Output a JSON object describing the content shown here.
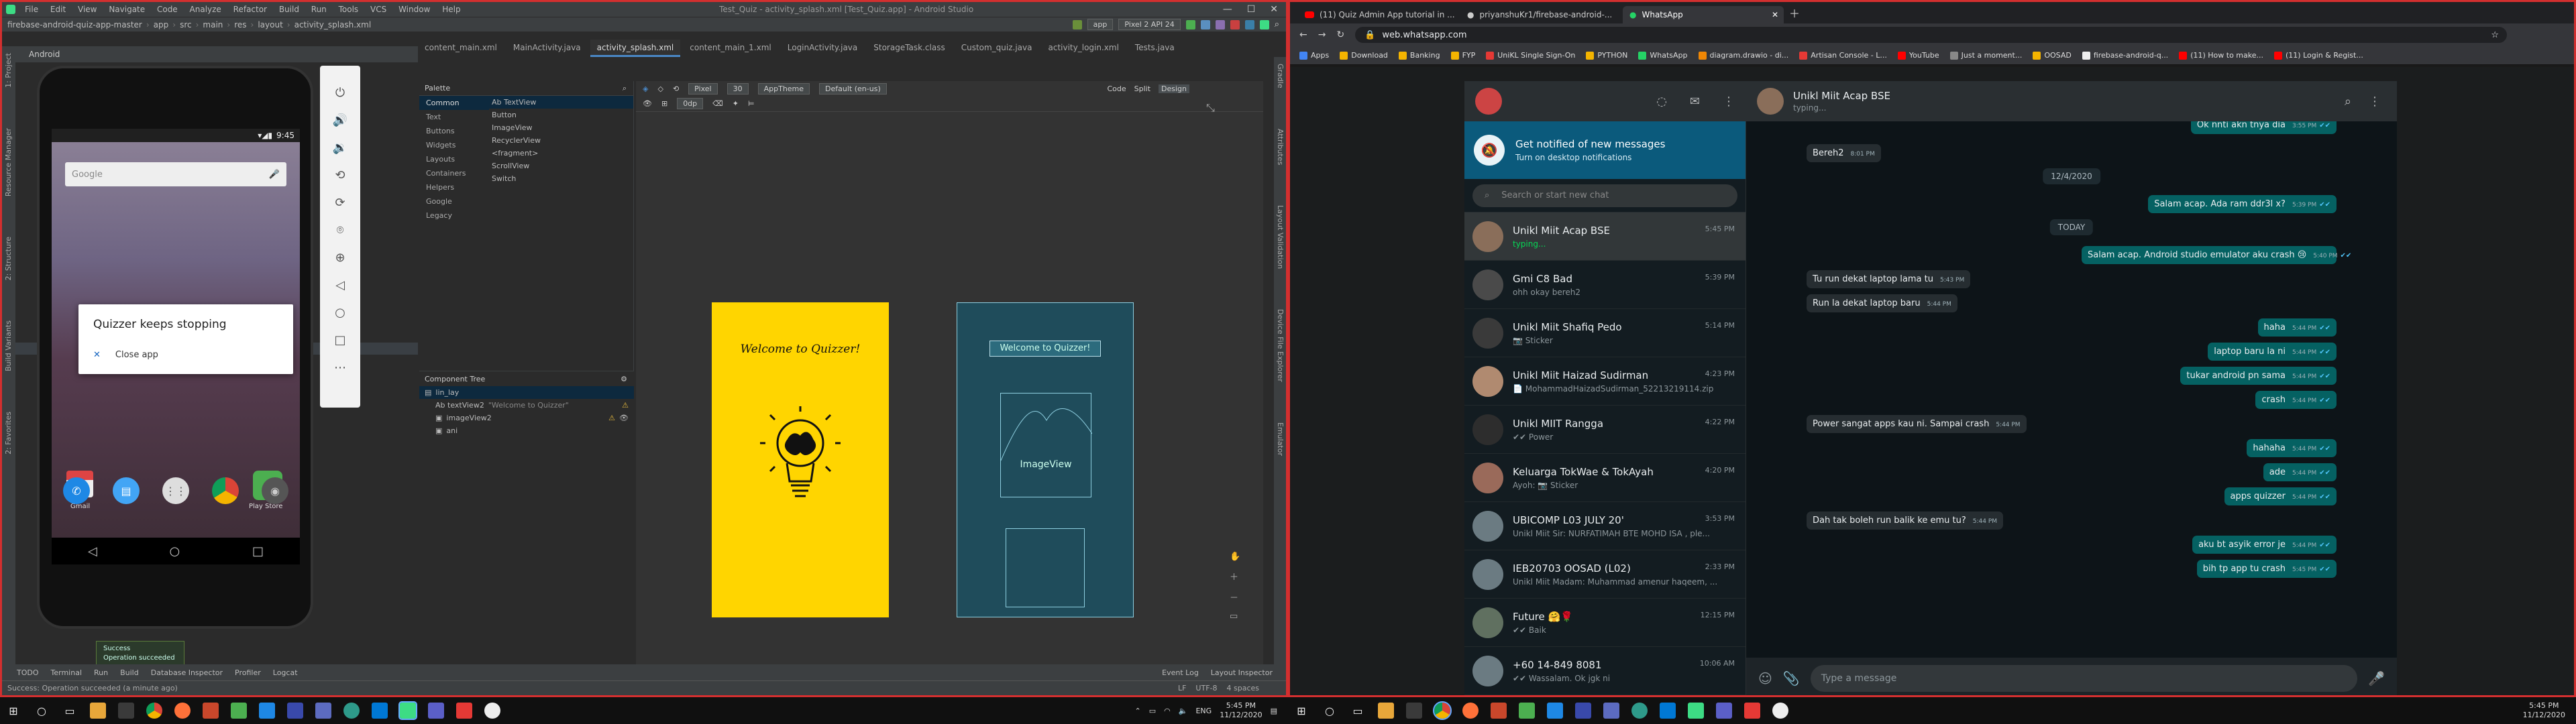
{
  "android_studio": {
    "window_title": "Test_Quiz - activity_splash.xml [Test_Quiz.app] - Android Studio",
    "project_name": "firebase-android-quiz-app-master",
    "menu": [
      "File",
      "Edit",
      "View",
      "Navigate",
      "Code",
      "Analyze",
      "Refactor",
      "Build",
      "Run",
      "Tools",
      "VCS",
      "Window",
      "Help"
    ],
    "breadcrumb": [
      "app",
      "src",
      "main",
      "res",
      "layout",
      "activity_splash.xml"
    ],
    "run_config": "app",
    "device": "Pixel 2 API 24",
    "file_tabs": [
      "content_main.xml",
      "MainActivity.java",
      "activity_splash.xml",
      "content_main_1.xml",
      "LoginActivity.java",
      "StorageTask.class",
      "Custom_quiz.java",
      "activity_login.xml",
      "Tests.java"
    ],
    "active_tab_index": 2,
    "project_view": "Android",
    "view_modes": [
      "Code",
      "Split",
      "Design"
    ],
    "palette": {
      "title": "Palette",
      "categories": [
        "Common",
        "Text",
        "Buttons",
        "Widgets",
        "Layouts",
        "Containers",
        "Helpers",
        "Google",
        "Legacy"
      ],
      "items": [
        "Ab TextView",
        "Button",
        "ImageView",
        "RecyclerView",
        "<fragment>",
        "ScrollView",
        "Switch"
      ]
    },
    "design_toolbar": {
      "device": "Pixel",
      "api": "30",
      "theme": "AppTheme",
      "locale": "Default (en-us)",
      "margin": "0dp"
    },
    "component_tree": {
      "title": "Component Tree",
      "root": "lin_lay",
      "children": [
        {
          "label": "Ab textView2",
          "extra": "\"Welcome to Quizzer\"",
          "warning": true
        },
        {
          "label": "imageView2",
          "extra": "",
          "warning": true
        },
        {
          "label": "ani",
          "extra": "",
          "warning": false
        }
      ]
    },
    "design_preview": {
      "welcome_text": "Welcome to Quizzer!",
      "blueprint_text": "Welcome to Quizzer!",
      "imageview_label": "ImageView"
    },
    "emulator": {
      "time": "9:45",
      "search_placeholder": "Google",
      "dialog_title": "Quizzer keeps stopping",
      "dialog_action": "Close app",
      "apps": [
        "Gmail",
        "Play Store"
      ]
    },
    "toast": {
      "line1": "Success",
      "line2": "Operation succeeded"
    },
    "bottom_tools": [
      "TODO",
      "Terminal",
      "Run",
      "Build",
      "Database Inspector",
      "Profiler",
      "Logcat",
      "Event Log",
      "Layout Inspector"
    ],
    "status_text": "Success: Operation succeeded (a minute ago)",
    "status_right": [
      "LF",
      "UTF-8",
      "4 spaces"
    ],
    "left_strip": [
      "1: Project",
      "Resource Manager",
      "2: Structure",
      "Build Variants",
      "2: Favorites"
    ],
    "right_strip": [
      "Gradle",
      "Attributes",
      "Layout Validation",
      "Device File Explorer",
      "Emulator"
    ]
  },
  "chrome": {
    "tabs": [
      {
        "title": "(11) Quiz Admin App tutorial in ..."
      },
      {
        "title": "priyanshuKr1/firebase-android-..."
      },
      {
        "title": "WhatsApp"
      }
    ],
    "active_tab": 2,
    "url": "web.whatsapp.com",
    "bookmarks": [
      "Apps",
      "Download",
      "Banking",
      "FYP",
      "UniKL Single Sign-On",
      "PYTHON",
      "WhatsApp",
      "diagram.drawio - di...",
      "Artisan Console - L...",
      "YouTube",
      "Just a moment...",
      "OOSAD",
      "firebase-android-q...",
      "(11) How to make...",
      "(11) Login & Regist..."
    ]
  },
  "whatsapp": {
    "notification_title": "Get notified of new messages",
    "notification_sub": "Turn on desktop notifications",
    "search_placeholder": "Search or start new chat",
    "active_chat": {
      "name": "Unikl Miit Acap BSE",
      "status": "typing..."
    },
    "chats": [
      {
        "name": "Unikl Miit Acap BSE",
        "time": "5:45 PM",
        "preview": "typing...",
        "typing": true,
        "color": "#8a6e5a"
      },
      {
        "name": "Gmi C8 Bad",
        "time": "5:39 PM",
        "preview": "ohh okay bereh2",
        "typing": false,
        "color": "#4a4a4a"
      },
      {
        "name": "Unikl Miit Shafiq Pedo",
        "time": "5:14 PM",
        "preview": "📷 Sticker",
        "typing": false,
        "color": "#3a3a3a"
      },
      {
        "name": "Unikl Miit Haizad Sudirman",
        "time": "4:23 PM",
        "preview": "📄 MohammadHaizadSudirman_52213219114.zip",
        "typing": false,
        "color": "#b08a70"
      },
      {
        "name": "Unikl MIIT Rangga",
        "time": "4:22 PM",
        "preview": "✔✔ Power",
        "typing": false,
        "color": "#2d2d2d"
      },
      {
        "name": "Keluarga TokWae & TokAyah",
        "time": "4:20 PM",
        "preview": "Ayoh: 📷 Sticker",
        "typing": false,
        "color": "#9a6a5a"
      },
      {
        "name": "UBICOMP L03 JULY 20'",
        "time": "3:53 PM",
        "preview": "Unikl Miit Sir: NURFATIMAH BTE MOHD ISA , ple...",
        "typing": false,
        "color": "#6b7b82"
      },
      {
        "name": "IEB20703 OOSAD (L02)",
        "time": "2:33 PM",
        "preview": "Unikl Miit Madam: Muhammad amenur haqeem, ...",
        "typing": false,
        "color": "#6b7b82"
      },
      {
        "name": "Future 🤗🌹",
        "time": "12:15 PM",
        "preview": "✔✔ Baik",
        "typing": false,
        "color": "#607060"
      },
      {
        "name": "+60 14-849 8081",
        "time": "10:06 AM",
        "preview": "✔✔ Wassalam. Ok jgk ni",
        "typing": false,
        "color": "#6b7b82"
      }
    ],
    "messages": [
      {
        "dir": "out",
        "text": "Ok nnti akn tnya dia",
        "time": "3:55 PM"
      },
      {
        "dir": "in",
        "text": "Bereh2",
        "time": "8:01 PM"
      },
      {
        "dir": "day",
        "text": "12/4/2020"
      },
      {
        "dir": "out",
        "text": "Salam acap. Ada ram ddr3l x?",
        "time": "5:39 PM"
      },
      {
        "dir": "day",
        "text": "TODAY"
      },
      {
        "dir": "out",
        "text": "Salam acap. Android studio emulator aku crash 😢",
        "time": "5:40 PM"
      },
      {
        "dir": "in",
        "text": "Tu run dekat laptop lama tu",
        "time": "5:43 PM"
      },
      {
        "dir": "in",
        "text": "Run la dekat laptop baru",
        "time": "5:44 PM"
      },
      {
        "dir": "out",
        "text": "haha",
        "time": "5:44 PM"
      },
      {
        "dir": "out",
        "text": "laptop baru la ni",
        "time": "5:44 PM"
      },
      {
        "dir": "out",
        "text": "tukar android pn sama",
        "time": "5:44 PM"
      },
      {
        "dir": "out",
        "text": "crash",
        "time": "5:44 PM"
      },
      {
        "dir": "in",
        "text": "Power sangat apps kau ni. Sampai crash",
        "time": "5:44 PM"
      },
      {
        "dir": "out",
        "text": "hahaha",
        "time": "5:44 PM"
      },
      {
        "dir": "out",
        "text": "ade",
        "time": "5:44 PM"
      },
      {
        "dir": "out",
        "text": "apps quizzer",
        "time": "5:44 PM"
      },
      {
        "dir": "in",
        "text": "Dah tak boleh run balik ke emu tu?",
        "time": "5:44 PM"
      },
      {
        "dir": "out",
        "text": "aku bt asyik error je",
        "time": "5:44 PM"
      },
      {
        "dir": "out",
        "text": "bih tp app tu crash",
        "time": "5:45 PM"
      }
    ],
    "composer_placeholder": "Type a message"
  },
  "taskbar": {
    "left_lang": "ENG",
    "time": "5:45 PM",
    "date": "11/12/2020",
    "right_time": "5:45 PM",
    "right_date": "11/12/2020"
  },
  "colors": {
    "accent_blue": "#4a88c7",
    "wa_out": "#056162",
    "wa_in": "#262d31",
    "design_yellow": "#ffd500",
    "blueprint": "#1f4c5b",
    "red_border": "#d32f2f"
  }
}
